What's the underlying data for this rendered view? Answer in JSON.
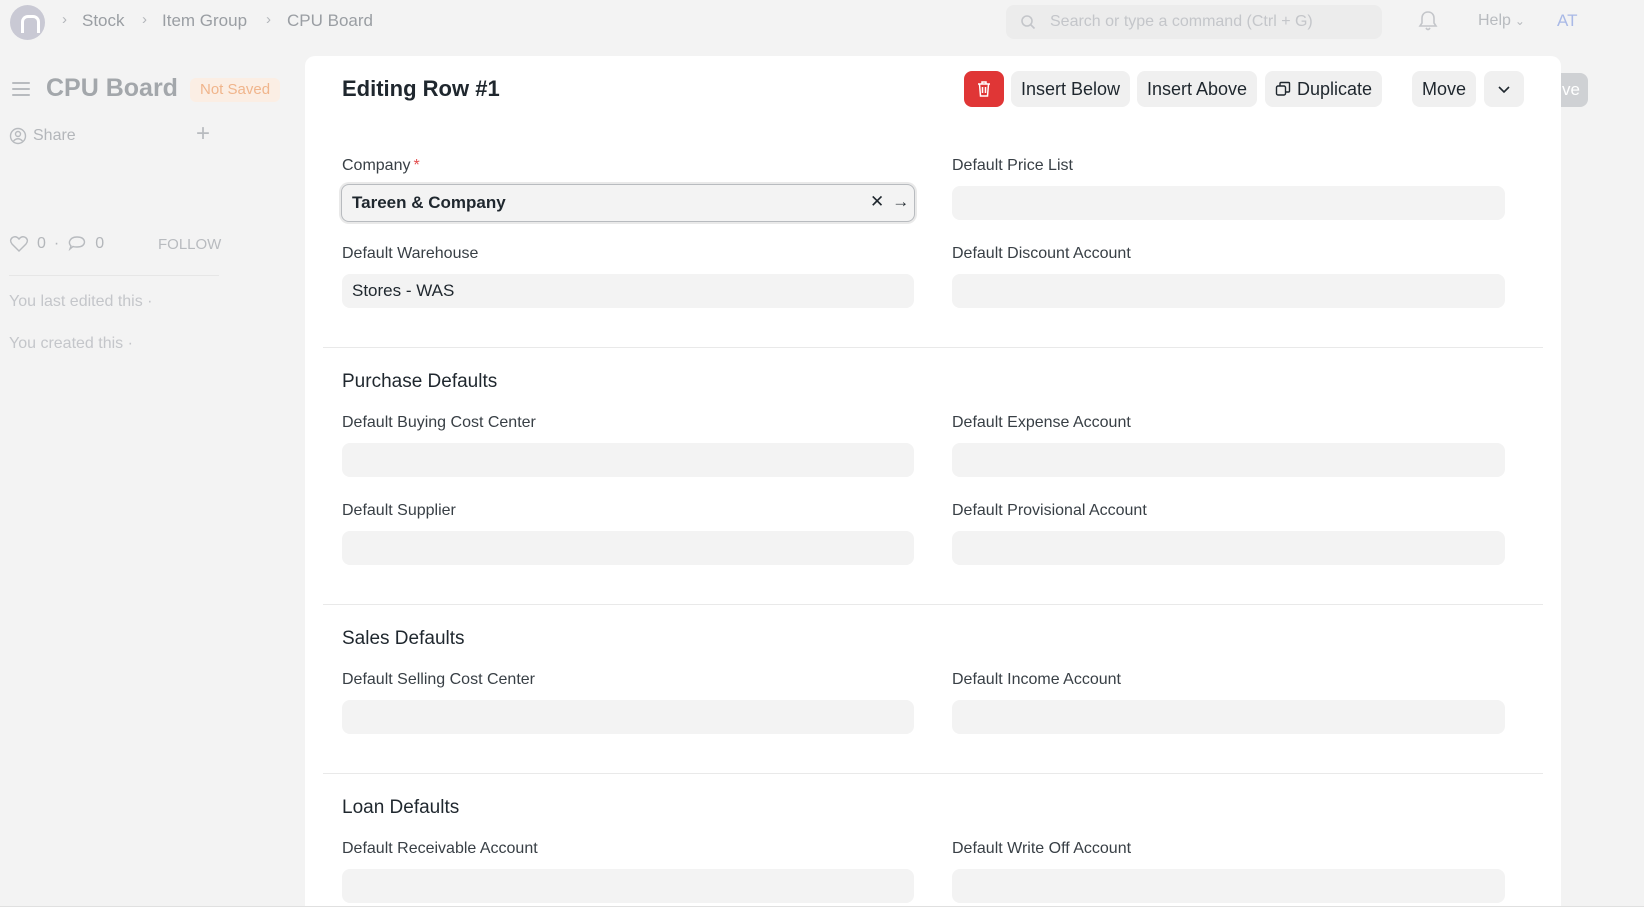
{
  "navbar": {
    "breadcrumbs": [
      "Stock",
      "Item Group",
      "CPU Board"
    ],
    "search_placeholder": "Search or type a command (Ctrl + G)",
    "help_label": "Help",
    "avatar_initials": "AT"
  },
  "sidebar": {
    "doc_title": "CPU Board",
    "status_badge": "Not Saved",
    "share_label": "Share",
    "likes_count": "0",
    "comments_count": "0",
    "follow_label": "FOLLOW",
    "last_edited": "You last edited this ·",
    "created": "You created this ·"
  },
  "background": {
    "save_label": "ve"
  },
  "dialog": {
    "title": "Editing Row #1",
    "toolbar": {
      "insert_below": "Insert Below",
      "insert_above": "Insert Above",
      "duplicate": "Duplicate",
      "move": "Move"
    },
    "fields": {
      "company_label": "Company",
      "company_value": "Tareen & Company",
      "default_price_list_label": "Default Price List",
      "default_price_list_value": "",
      "default_warehouse_label": "Default Warehouse",
      "default_warehouse_value": "Stores - WAS",
      "default_discount_account_label": "Default Discount Account",
      "default_discount_account_value": ""
    },
    "sections": {
      "purchase": {
        "title": "Purchase Defaults",
        "buying_cost_center_label": "Default Buying Cost Center",
        "expense_account_label": "Default Expense Account",
        "supplier_label": "Default Supplier",
        "provisional_account_label": "Default Provisional Account"
      },
      "sales": {
        "title": "Sales Defaults",
        "selling_cost_center_label": "Default Selling Cost Center",
        "income_account_label": "Default Income Account"
      },
      "loan": {
        "title": "Loan Defaults",
        "receivable_account_label": "Default Receivable Account",
        "write_off_account_label": "Default Write Off Account"
      }
    }
  },
  "colors": {
    "danger": "#e03636",
    "required": "#e24c4c",
    "status_badge_text": "#f0b58c"
  }
}
